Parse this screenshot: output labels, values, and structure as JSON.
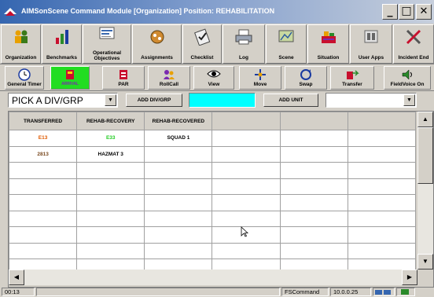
{
  "window": {
    "title": "AIMSonScene Command Module [Organization] Position: REHABILITATION",
    "minimize": "_",
    "maximize": "□",
    "close": "✕"
  },
  "toolbar_main": [
    {
      "label": "Organization",
      "icon": "people-icon"
    },
    {
      "label": "Benchmarks",
      "icon": "chart-icon"
    },
    {
      "label": "Operational Objectives",
      "icon": "objectives-icon"
    },
    {
      "label": "Assignments",
      "icon": "assignments-icon"
    },
    {
      "label": "Checklist",
      "icon": "checklist-icon"
    },
    {
      "label": "Log",
      "icon": "printer-icon"
    },
    {
      "label": "Scene",
      "icon": "scene-icon"
    },
    {
      "label": "Situation",
      "icon": "situation-icon"
    },
    {
      "label": "User Apps",
      "icon": "apps-icon"
    },
    {
      "label": "Incident End",
      "icon": "tools-icon"
    }
  ],
  "toolbar_secondary": [
    {
      "label": "General Timer",
      "icon": "timer-icon"
    },
    {
      "label": "ARRIVAL",
      "icon": "arrival-icon"
    },
    {
      "label": "PAR",
      "icon": "par-icon"
    },
    {
      "label": "RollCall",
      "icon": "rollcall-icon"
    },
    {
      "label": "View",
      "icon": "eye-icon"
    },
    {
      "label": "Move",
      "icon": "move-icon"
    },
    {
      "label": "Swap",
      "icon": "swap-icon"
    },
    {
      "label": "Transfer",
      "icon": "transfer-icon"
    },
    {
      "label": "FieldVoice On",
      "icon": "speaker-icon"
    }
  ],
  "controls": {
    "divgrp_value": "PICK A DIV/GRP",
    "add_div_grp": "ADD DIV/GRP",
    "cyan_value": "",
    "add_unit": "ADD UNIT",
    "unit_value": "",
    "dropdown_arrow": "▼"
  },
  "grid": {
    "columns": [
      "TRANSFERRED",
      "REHAB-RECOVERY",
      "REHAB-RECOVERED",
      "",
      "",
      ""
    ],
    "rows": [
      [
        "E13",
        "E33",
        "SQUAD 1",
        "",
        "",
        ""
      ],
      [
        "2813",
        "HAZMAT 3",
        "",
        "",
        "",
        ""
      ]
    ]
  },
  "scroll": {
    "up": "▲",
    "down": "▼",
    "left": "◀",
    "right": "▶"
  },
  "status": {
    "time": "00:13",
    "message": "",
    "mode": "FSCommand",
    "ip": "10.0.0.25"
  },
  "colors": {
    "title_gradient_start": "#3566b0",
    "arrival_bg": "#22dd22",
    "cyan_box": "#00ffff",
    "transferred_text": "#e05a00",
    "recovery_text": "#22cc22"
  }
}
